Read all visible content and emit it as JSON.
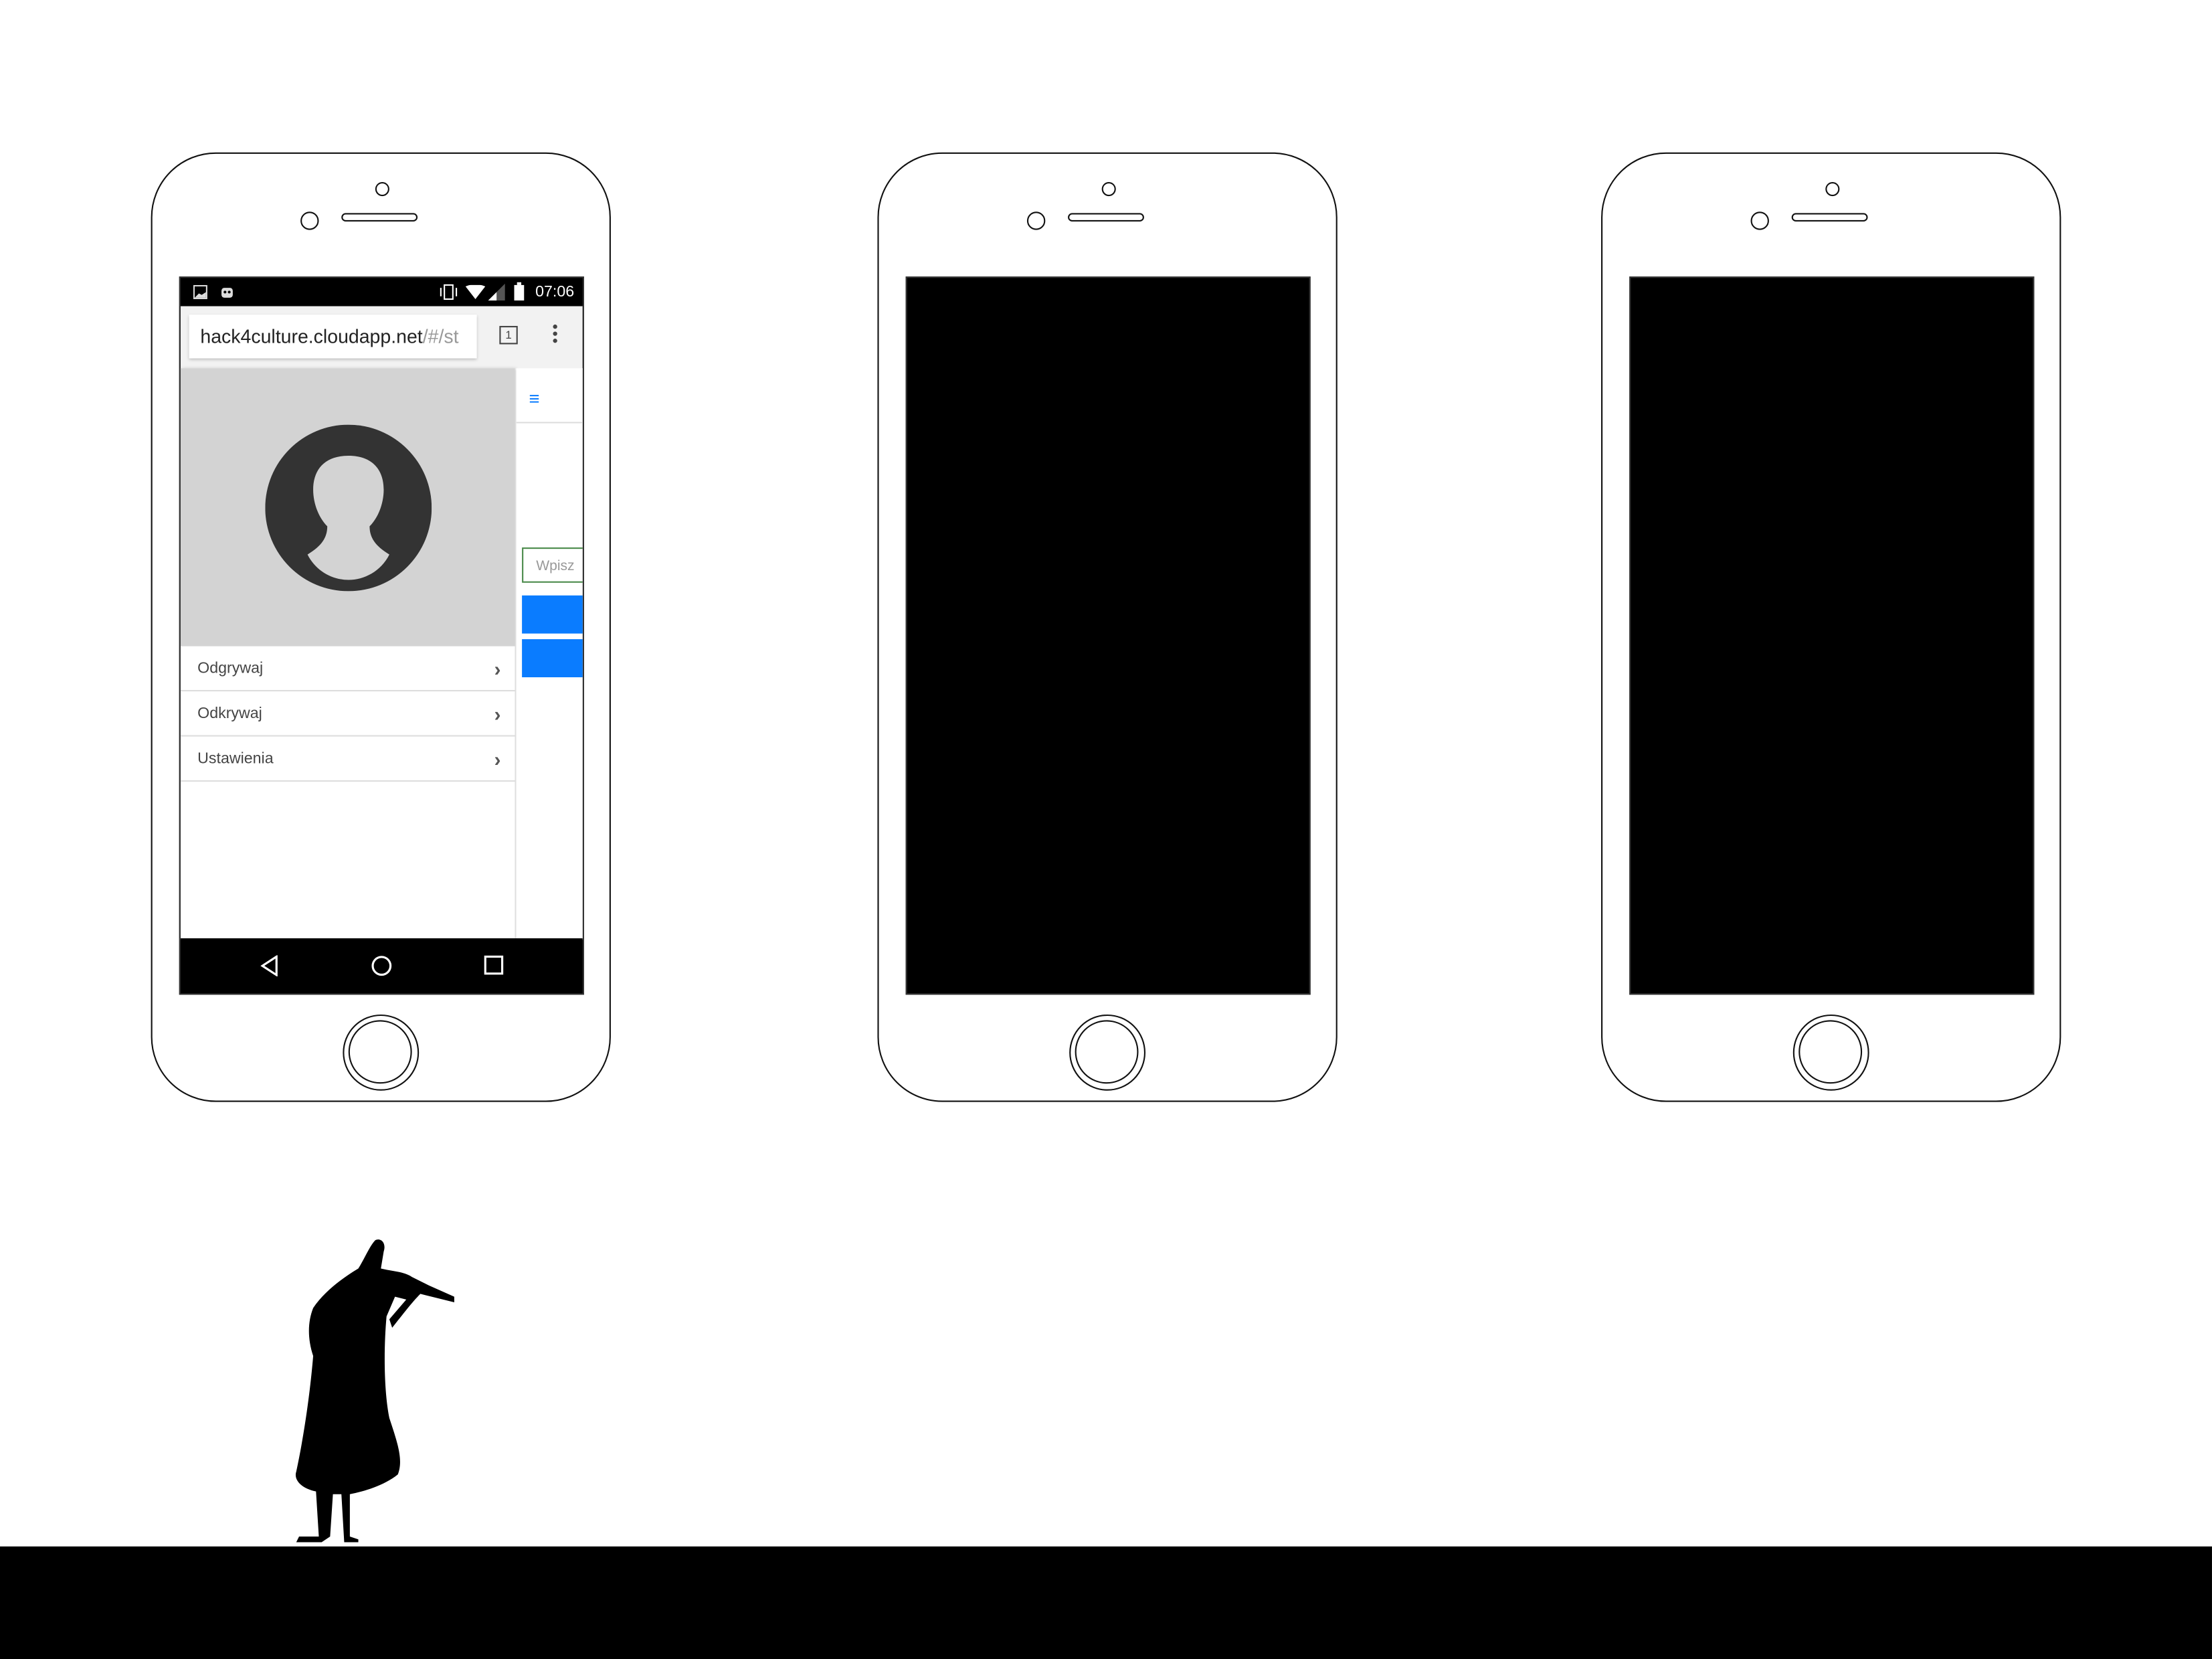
{
  "status_bar": {
    "time": "07:06"
  },
  "browser": {
    "url_host": "hack4culture.cloudapp.net",
    "url_path": "/#/st",
    "tab_count": "1"
  },
  "drawer": {
    "menu_items": [
      {
        "label": "Odgrywaj"
      },
      {
        "label": "Odkrywaj"
      },
      {
        "label": "Ustawienia"
      }
    ]
  },
  "side_panel": {
    "hamburger": "≡",
    "input_placeholder": "Wpisz"
  },
  "colors": {
    "accent": "#0a7cff",
    "drawer_header": "#d3d3d3"
  }
}
